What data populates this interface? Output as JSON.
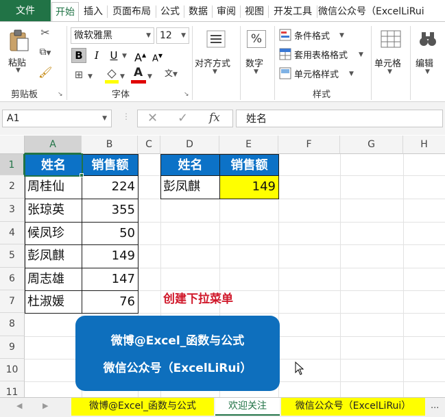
{
  "ribbon_tabs": [
    "文件",
    "开始",
    "插入",
    "页面布局",
    "公式",
    "数据",
    "审阅",
    "视图",
    "开发工具",
    "微信公众号（ExcelLiRui"
  ],
  "ribbon": {
    "paste_label": "粘贴",
    "clipboard_group": "剪贴板",
    "font_name": "微软雅黑",
    "font_size": "12",
    "bold": "B",
    "italic": "I",
    "underline": "U",
    "grow_font": "A",
    "shrink_font": "A",
    "font_color_letter": "A",
    "phonetic": "文",
    "font_group": "字体",
    "align_label": "对齐方式",
    "number_label": "数字",
    "number_symbol": "%",
    "conditional_format": "条件格式",
    "table_format": "套用表格格式",
    "cell_style": "单元格样式",
    "styles_group": "样式",
    "cells_label": "单元格",
    "edit_label": "编辑"
  },
  "formula_bar": {
    "name_box": "A1",
    "fx": "fx",
    "formula": "姓名"
  },
  "columns": [
    "A",
    "B",
    "C",
    "D",
    "E",
    "F",
    "G",
    "H"
  ],
  "rows": [
    "1",
    "2",
    "3",
    "4",
    "5",
    "6",
    "7",
    "8",
    "9",
    "10",
    "11"
  ],
  "table1": {
    "header": [
      "姓名",
      "销售额"
    ],
    "rows": [
      [
        "周桂仙",
        "224"
      ],
      [
        "张琼英",
        "355"
      ],
      [
        "候凤珍",
        "50"
      ],
      [
        "彭凤麒",
        "149"
      ],
      [
        "周志雄",
        "147"
      ],
      [
        "杜淑媛",
        "76"
      ]
    ]
  },
  "table2": {
    "header": [
      "姓名",
      "销售额"
    ],
    "row": [
      "彭凤麒",
      "149"
    ]
  },
  "annotation": "创建下拉菜单",
  "banner": {
    "line1": "微博@Excel_函数与公式",
    "line2": "微信公众号（ExcelLiRui）"
  },
  "sheet_tabs": [
    "微博@Excel_函数与公式",
    "欢迎关注",
    "微信公众号（ExcelLiRui）"
  ],
  "sheet_more": "...",
  "colors": {
    "accent": "#217346",
    "header_fill": "#0c72c7",
    "highlight": "#ffff00",
    "annotation": "#d0182a",
    "banner": "#0e6fbd"
  }
}
